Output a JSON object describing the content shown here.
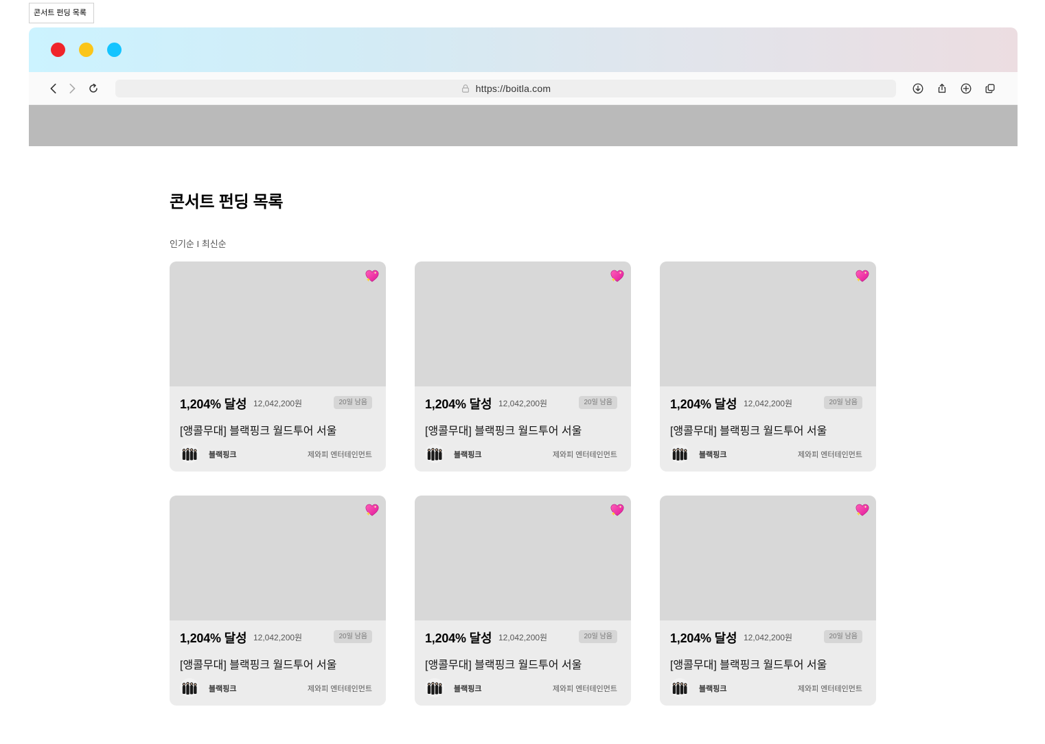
{
  "frame_label": "콘서트 펀딩 목록",
  "browser": {
    "url": "https://boitla.com",
    "colors": {
      "close": "#f0242a",
      "minimize": "#fbc519",
      "zoom": "#14c4ff"
    }
  },
  "page": {
    "title": "콘서트 펀딩 목록",
    "sort": {
      "popular": "인기순",
      "separator": " I ",
      "latest": "최신순"
    }
  },
  "cards": [
    {
      "achieve": "1,204% 달성",
      "amount": "12,042,200원",
      "badge": "20일 남음",
      "title": "[앵콜무대] 블랙핑크 월드투어 서울",
      "artist": "블랙핑크",
      "agency": "제와피 엔터테인먼트"
    },
    {
      "achieve": "1,204% 달성",
      "amount": "12,042,200원",
      "badge": "20일 남음",
      "title": "[앵콜무대] 블랙핑크 월드투어 서울",
      "artist": "블랙핑크",
      "agency": "제와피 엔터테인먼트"
    },
    {
      "achieve": "1,204% 달성",
      "amount": "12,042,200원",
      "badge": "20일 남음",
      "title": "[앵콜무대] 블랙핑크 월드투어 서울",
      "artist": "블랙핑크",
      "agency": "제와피 엔터테인먼트"
    },
    {
      "achieve": "1,204% 달성",
      "amount": "12,042,200원",
      "badge": "20일 남음",
      "title": "[앵콜무대] 블랙핑크 월드투어 서울",
      "artist": "블랙핑크",
      "agency": "제와피 엔터테인먼트"
    },
    {
      "achieve": "1,204% 달성",
      "amount": "12,042,200원",
      "badge": "20일 남음",
      "title": "[앵콜무대] 블랙핑크 월드투어 서울",
      "artist": "블랙핑크",
      "agency": "제와피 엔터테인먼트"
    },
    {
      "achieve": "1,204% 달성",
      "amount": "12,042,200원",
      "badge": "20일 남음",
      "title": "[앵콜무대] 블랙핑크 월드투어 서울",
      "artist": "블랙핑크",
      "agency": "제와피 엔터테인먼트"
    }
  ]
}
